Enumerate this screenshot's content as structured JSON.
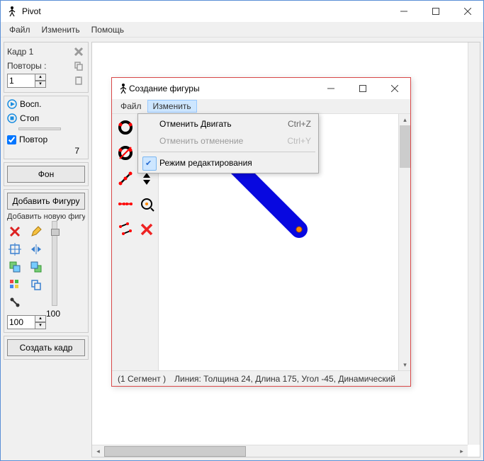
{
  "main": {
    "title": "Pivot",
    "menu": {
      "file": "Файл",
      "edit": "Изменить",
      "help": "Помощь"
    },
    "frame": {
      "label": "Кадр 1",
      "repeats_label": "Повторы :",
      "repeats_value": "1"
    },
    "playback": {
      "play": "Восп.",
      "stop": "Стоп",
      "repeat": "Повтор",
      "count": "7"
    },
    "bg_btn": "Фон",
    "add_figure_btn": "Добавить Фигуру",
    "add_new_label": "Добавить новую фигуру",
    "scale_value": "100",
    "scale_label": "100",
    "create_frame_btn": "Создать кадр"
  },
  "child": {
    "title": "Создание фигуры",
    "menu": {
      "file": "Файл",
      "edit": "Изменить"
    },
    "status_seg": "(1 Сегмент )",
    "status_line": "Линия: Толщина 24, Длина 175, Угол -45, Динамический"
  },
  "dropdown": {
    "undo": "Отменить Двигать",
    "undo_key": "Ctrl+Z",
    "redo": "Отменить отменение",
    "redo_key": "Ctrl+Y",
    "edit_mode": "Режим редактирования"
  },
  "icons": {
    "pivot_man": "stick-figure"
  }
}
